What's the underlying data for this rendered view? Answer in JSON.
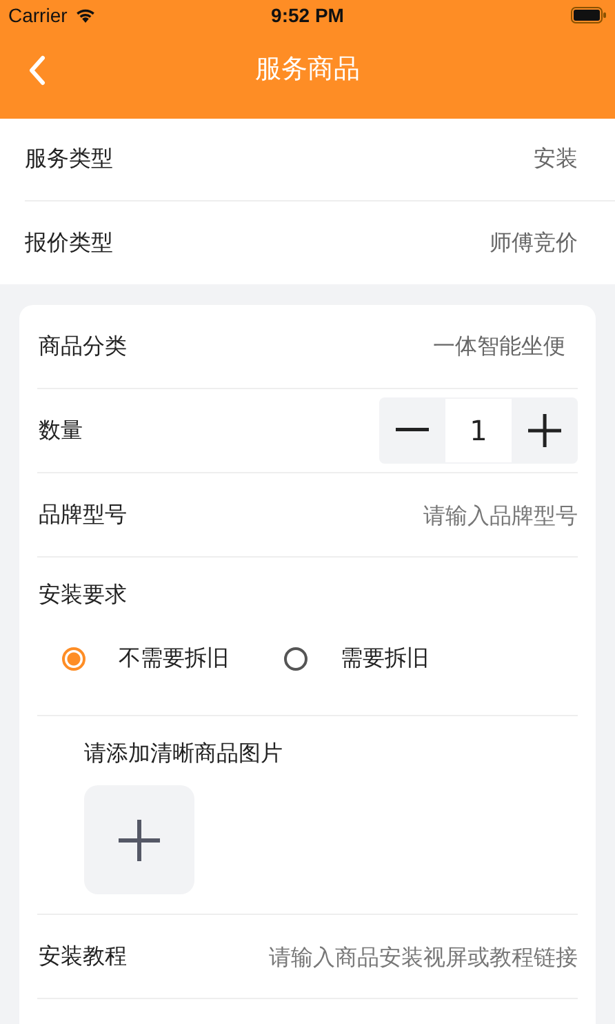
{
  "status_bar": {
    "carrier": "Carrier",
    "time": "9:52 PM"
  },
  "nav_bar": {
    "title": "服务商品"
  },
  "summary_rows": [
    {
      "label": "服务类型",
      "value": "安装"
    },
    {
      "label": "报价类型",
      "value": "师傅竞价"
    }
  ],
  "product": {
    "category": {
      "label": "商品分类",
      "value": "一体智能坐便"
    },
    "quantity": {
      "label": "数量",
      "value": "1"
    },
    "brand_model": {
      "label": "品牌型号",
      "placeholder": "请输入品牌型号"
    },
    "install_requirement": {
      "label": "安装要求",
      "options": [
        {
          "label": "不需要拆旧",
          "selected": true
        },
        {
          "label": "需要拆旧",
          "selected": false
        }
      ]
    },
    "photos": {
      "label": "请添加清晰商品图片"
    },
    "tutorial": {
      "label": "安装教程",
      "placeholder": "请输入商品安装视屏或教程链接"
    }
  }
}
